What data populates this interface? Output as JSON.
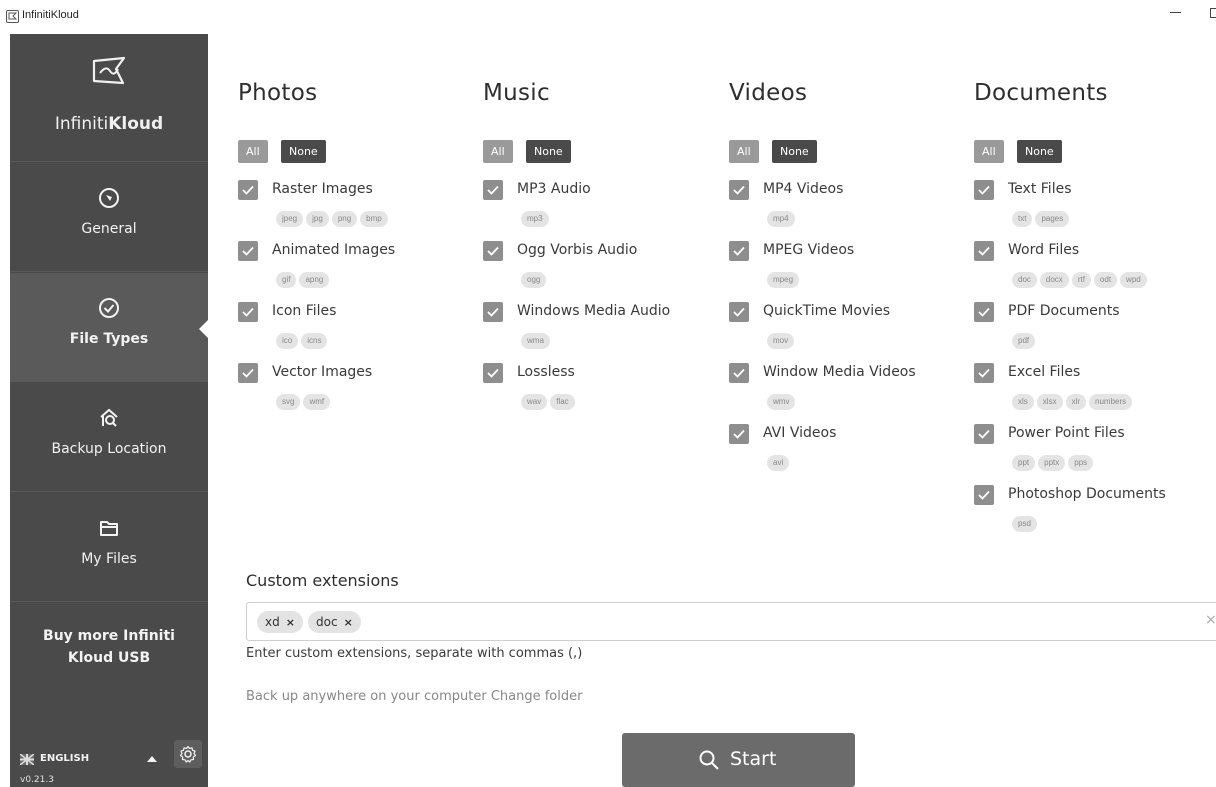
{
  "window": {
    "title": "InfinitiKloud"
  },
  "sidebar": {
    "brand_light": "Infiniti",
    "brand_bold": "Kloud",
    "items": [
      {
        "label": "General",
        "icon": "compass-icon"
      },
      {
        "label": "File Types",
        "icon": "check-circle-icon",
        "active": true
      },
      {
        "label": "Backup Location",
        "icon": "home-search-icon"
      },
      {
        "label": "My Files",
        "icon": "folder-icon"
      }
    ],
    "buy_label_line1": "Buy more Infiniti",
    "buy_label_line2": "Kloud USB",
    "language": "ENGLISH",
    "version": "v0.21.3"
  },
  "categories": [
    {
      "title": "Photos",
      "all_label": "All",
      "none_label": "None",
      "types": [
        {
          "label": "Raster Images",
          "exts": [
            "jpeg",
            "jpg",
            "png",
            "bmp"
          ],
          "checked": true
        },
        {
          "label": "Animated Images",
          "exts": [
            "gif",
            "apng"
          ],
          "checked": true
        },
        {
          "label": "Icon Files",
          "exts": [
            "ico",
            "icns"
          ],
          "checked": true
        },
        {
          "label": "Vector Images",
          "exts": [
            "svg",
            "wmf"
          ],
          "checked": true
        }
      ]
    },
    {
      "title": "Music",
      "all_label": "All",
      "none_label": "None",
      "types": [
        {
          "label": "MP3 Audio",
          "exts": [
            "mp3"
          ],
          "checked": true
        },
        {
          "label": "Ogg Vorbis Audio",
          "exts": [
            "ogg"
          ],
          "checked": true
        },
        {
          "label": "Windows Media Audio",
          "exts": [
            "wma"
          ],
          "checked": true
        },
        {
          "label": "Lossless",
          "exts": [
            "wav",
            "flac"
          ],
          "checked": true
        }
      ]
    },
    {
      "title": "Videos",
      "all_label": "All",
      "none_label": "None",
      "types": [
        {
          "label": "MP4 Videos",
          "exts": [
            "mp4"
          ],
          "checked": true
        },
        {
          "label": "MPEG Videos",
          "exts": [
            "mpeg"
          ],
          "checked": true
        },
        {
          "label": "QuickTime Movies",
          "exts": [
            "mov"
          ],
          "checked": true
        },
        {
          "label": "Window Media Videos",
          "exts": [
            "wmv"
          ],
          "checked": true
        },
        {
          "label": "AVI Videos",
          "exts": [
            "avi"
          ],
          "checked": true
        }
      ]
    },
    {
      "title": "Documents",
      "all_label": "All",
      "none_label": "None",
      "types": [
        {
          "label": "Text Files",
          "exts": [
            "txt",
            "pages"
          ],
          "checked": true
        },
        {
          "label": "Word Files",
          "exts": [
            "doc",
            "docx",
            "rtf",
            "odt",
            "wpd"
          ],
          "checked": true
        },
        {
          "label": "PDF Documents",
          "exts": [
            "pdf"
          ],
          "checked": true
        },
        {
          "label": "Excel Files",
          "exts": [
            "xls",
            "xlsx",
            "xlr",
            "numbers"
          ],
          "checked": true
        },
        {
          "label": "Power Point Files",
          "exts": [
            "ppt",
            "pptx",
            "pps"
          ],
          "checked": true
        },
        {
          "label": "Photoshop Documents",
          "exts": [
            "psd"
          ],
          "checked": true
        }
      ]
    }
  ],
  "custom": {
    "title": "Custom extensions",
    "tags": [
      "xd",
      "doc"
    ],
    "tag_remove": "×",
    "clear": "×",
    "hint": "Enter custom extensions, separate with commas (,)"
  },
  "backup": {
    "text": "Back up anywhere on your computer",
    "change_label": "Change folder"
  },
  "start_label": "Start",
  "colors": {
    "sidebar": "#4a4a4a",
    "active_nav": "#5a5a5a",
    "checkbox": "#8e8e8e",
    "start_button": "#6b6b6b"
  }
}
